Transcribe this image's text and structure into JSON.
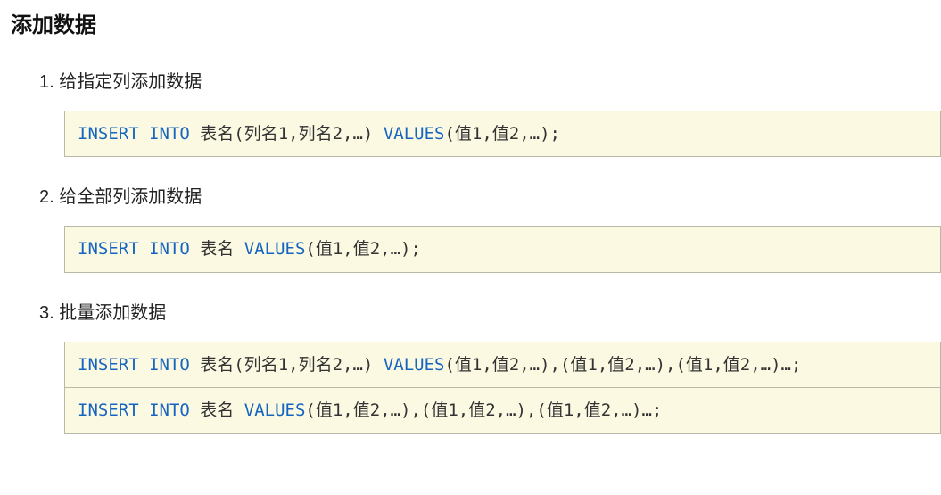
{
  "title": "添加数据",
  "sections": [
    {
      "num": "1.",
      "label": "给指定列添加数据",
      "code": [
        [
          {
            "kw": "INSERT"
          },
          " ",
          {
            "kw": "INTO"
          },
          " 表名(列名1,列名2,…) ",
          {
            "kw": "VALUES"
          },
          "(值1,值2,…);"
        ]
      ]
    },
    {
      "num": "2.",
      "label": "给全部列添加数据",
      "code": [
        [
          {
            "kw": "INSERT"
          },
          " ",
          {
            "kw": "INTO"
          },
          " 表名 ",
          {
            "kw": "VALUES"
          },
          "(值1,值2,…);"
        ]
      ]
    },
    {
      "num": "3.",
      "label": "批量添加数据",
      "code": [
        [
          {
            "kw": "INSERT"
          },
          " ",
          {
            "kw": "INTO"
          },
          " 表名(列名1,列名2,…) ",
          {
            "kw": "VALUES"
          },
          "(值1,值2,…),(值1,值2,…),(值1,值2,…)…;"
        ],
        [
          {
            "kw": "INSERT"
          },
          " ",
          {
            "kw": "INTO"
          },
          " 表名 ",
          {
            "kw": "VALUES"
          },
          "(值1,值2,…),(值1,值2,…),(值1,值2,…)…;"
        ]
      ]
    }
  ]
}
